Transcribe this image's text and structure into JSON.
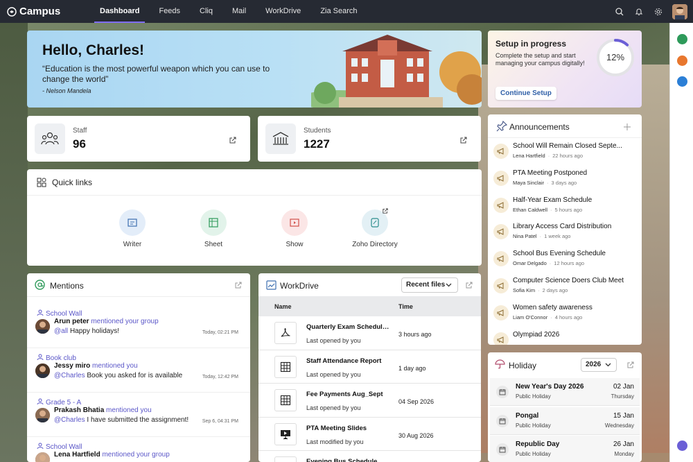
{
  "app": {
    "name": "Campus"
  },
  "nav": [
    {
      "label": "Dashboard",
      "active": true
    },
    {
      "label": "Feeds"
    },
    {
      "label": "Cliq"
    },
    {
      "label": "Mail"
    },
    {
      "label": "WorkDrive"
    },
    {
      "label": "Zia Search"
    }
  ],
  "topbar_icons": [
    "search-icon",
    "bell-icon",
    "settings-icon",
    "user-avatar"
  ],
  "hero": {
    "greeting": "Hello, Charles!",
    "quote": "“Education is the most powerful weapon which you can use to change the world”",
    "author": "- Nelson Mandela"
  },
  "setup": {
    "title": "Setup in progress",
    "desc": "Complete the setup and start managing your campus digitally!",
    "button": "Continue Setup",
    "percent_text": "12%",
    "progress": 0.12
  },
  "stats": [
    {
      "label": "Staff",
      "value": "96"
    },
    {
      "label": "Students",
      "value": "1227"
    }
  ],
  "quick_links": {
    "title": "Quick links",
    "items": [
      {
        "label": "Writer",
        "color": "#e3edf9"
      },
      {
        "label": "Sheet",
        "color": "#e2f3ea"
      },
      {
        "label": "Show",
        "color": "#fbe6e6"
      },
      {
        "label": "Zoho Directory",
        "color": "#e3f0f5"
      }
    ]
  },
  "announcements": {
    "title": "Announcements",
    "items": [
      {
        "title": "School Will Remain Closed Septe...",
        "author": "Lena Hartfield",
        "time": "22 hours ago"
      },
      {
        "title": "PTA Meeting Postponed",
        "author": "Maya Sinclair",
        "time": "3 days ago"
      },
      {
        "title": "Half-Year Exam Schedule",
        "author": "Ethan Caldwell",
        "time": "5 hours ago"
      },
      {
        "title": "Library Access Card Distribution",
        "author": "Nina Patel",
        "time": "1 week ago"
      },
      {
        "title": "School Bus Evening Schedule",
        "author": "Omar Delgado",
        "time": "12 hours ago"
      },
      {
        "title": "Computer Science Doers Club Meet",
        "author": "Sofia Kim",
        "time": "2 days ago"
      },
      {
        "title": "Women safety awareness",
        "author": "Liam O'Connor",
        "time": "4 hours ago"
      },
      {
        "title": "Olympiad 2026",
        "author": "",
        "time": ""
      }
    ]
  },
  "mentions": {
    "title": "Mentions",
    "items": [
      {
        "group": "School Wall",
        "name": "Arun peter",
        "verb": "mentioned your group",
        "at": "@all",
        "text": "Happy holidays!",
        "time": "Today, 02:21 PM"
      },
      {
        "group": "Book club",
        "name": "Jessy miro",
        "verb": "mentioned you",
        "at": "@Charles",
        "text": "Book you asked for is available",
        "time": "Today, 12:42 PM"
      },
      {
        "group": "Grade 5 - A",
        "name": "Prakash Bhatia",
        "verb": "mentioned you",
        "at": "@Charles",
        "text": "I have submitted the assignment!",
        "time": "Sep 6, 04:31 PM"
      },
      {
        "group": "School Wall",
        "name": "Lena Hartfield",
        "verb": "mentioned your group",
        "at": "",
        "text": "",
        "time": ""
      }
    ]
  },
  "workdrive": {
    "title": "WorkDrive",
    "filter": "Recent files",
    "columns": [
      "Name",
      "Time"
    ],
    "files": [
      {
        "name": "Quarterly Exam Schedule...",
        "status": "Last opened by you",
        "time": "3 hours ago",
        "icon": "pdf-icon"
      },
      {
        "name": "Staff Attendance Report",
        "status": "Last opened by you",
        "time": "1 day ago",
        "icon": "sheet-icon"
      },
      {
        "name": "Fee Payments Aug_Sept",
        "status": "Last opened by you",
        "time": "04 Sep 2026",
        "icon": "sheet-icon"
      },
      {
        "name": "PTA Meeting Slides",
        "status": "Last modified by you",
        "time": "30 Aug 2026",
        "icon": "slides-icon"
      },
      {
        "name": "Evening Bus Schedule.png",
        "status": "",
        "time": "",
        "icon": "image-icon"
      }
    ]
  },
  "holiday": {
    "title": "Holiday",
    "year": "2026",
    "items": [
      {
        "name": "New Year's Day 2026",
        "type": "Public Holiday",
        "date": "02 Jan",
        "day": "Thursday"
      },
      {
        "name": "Pongal",
        "type": "Public Holiday",
        "date": "15 Jan",
        "day": "Wednesday"
      },
      {
        "name": "Republic Day",
        "type": "Public Holiday",
        "date": "26 Jan",
        "day": "Monday"
      }
    ]
  },
  "colors": {
    "accent": "#7e6cf2",
    "topbar": "#262a33",
    "link": "#5a56c8"
  }
}
